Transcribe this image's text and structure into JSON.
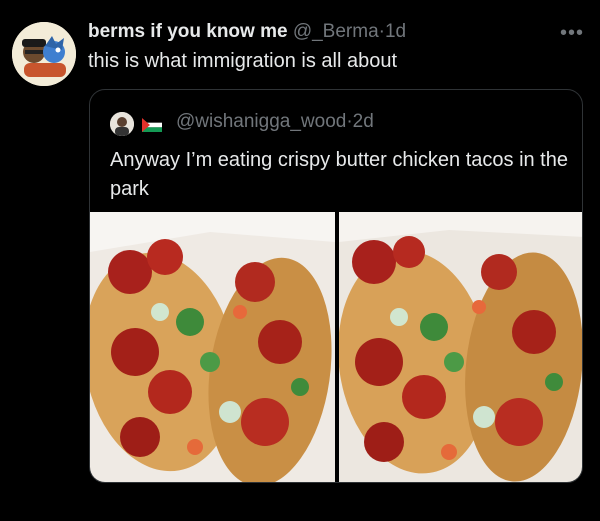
{
  "tweet": {
    "display_name": "berms if you know me",
    "handle": "@_Berma",
    "separator": "·",
    "time": "1d",
    "text": "this is what immigration is all about",
    "more_icon": "more-horizontal-icon"
  },
  "quoted": {
    "handle": "@wishanigga_wood",
    "separator": "·",
    "time": "2d",
    "text": "Anyway I’m eating crispy butter chicken tacos in the park",
    "images": [
      "tacos-photo-1",
      "tacos-photo-2"
    ]
  },
  "colors": {
    "background": "#000000",
    "text": "#e7e9ea",
    "muted": "#71767b",
    "border": "#2f3336"
  }
}
